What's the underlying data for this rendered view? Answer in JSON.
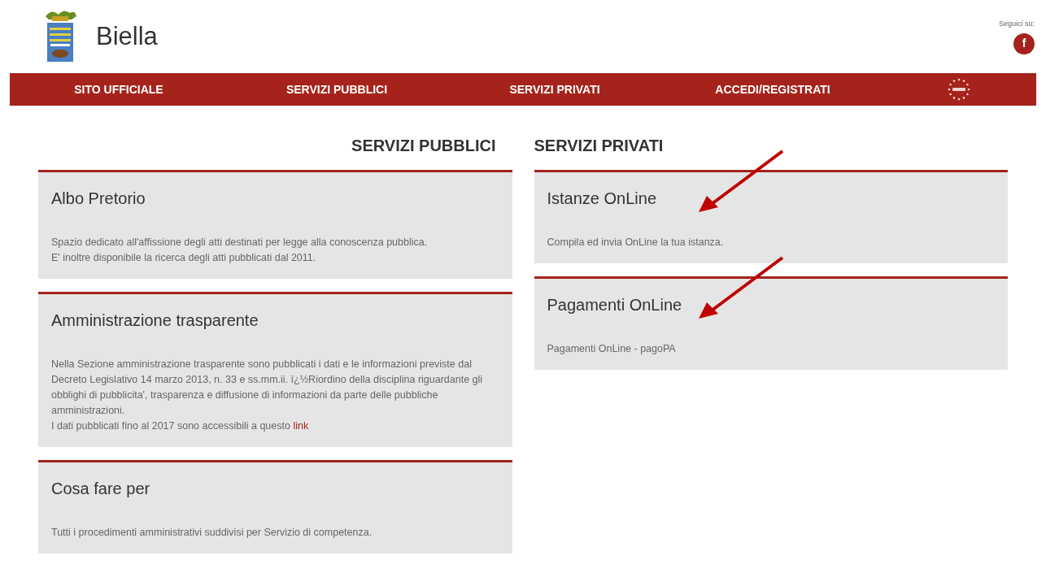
{
  "header": {
    "site_name": "Biella",
    "social_label": "Seguici su:",
    "social_icon_text": "f"
  },
  "nav": [
    {
      "label": "SITO UFFICIALE"
    },
    {
      "label": "SERVIZI PUBBLICI"
    },
    {
      "label": "SERVIZI PRIVATI"
    },
    {
      "label": "ACCEDI/REGISTRATI"
    }
  ],
  "columns": [
    {
      "heading": "SERVIZI PUBBLICI",
      "cards": [
        {
          "title": "Albo Pretorio",
          "paragraphs": [
            {
              "text": "Spazio dedicato all'affissione degli atti destinati per legge alla conoscenza pubblica."
            },
            {
              "text": "E' inoltre disponibile la ricerca degli atti pubblicati dal 2011."
            }
          ]
        },
        {
          "title": "Amministrazione trasparente",
          "paragraphs": [
            {
              "text": "Nella Sezione amministrazione trasparente sono pubblicati i dati e le informazioni previste dal Decreto Legislativo 14 marzo 2013, n. 33 e ss.mm.ii. ï¿½Riordino della disciplina riguardante gli obblighi di pubblicita', trasparenza e diffusione di informazioni da parte delle pubbliche amministrazioni."
            },
            {
              "text": "I dati pubblicati fino al 2017 sono accessibili a questo",
              "link": "link"
            }
          ]
        },
        {
          "title": "Cosa fare per",
          "paragraphs": [
            {
              "text": "Tutti i procedimenti amministrativi suddivisi per Servizio di competenza."
            }
          ]
        }
      ]
    },
    {
      "heading": "SERVIZI PRIVATI",
      "cards": [
        {
          "title": "Istanze OnLine",
          "paragraphs": [
            {
              "text": "Compila ed invia OnLine la tua istanza."
            }
          ],
          "annotated": true
        },
        {
          "title": "Pagamenti OnLine",
          "paragraphs": [
            {
              "text": "Pagamenti OnLine - pagoPA"
            }
          ],
          "annotated": true
        }
      ]
    }
  ]
}
